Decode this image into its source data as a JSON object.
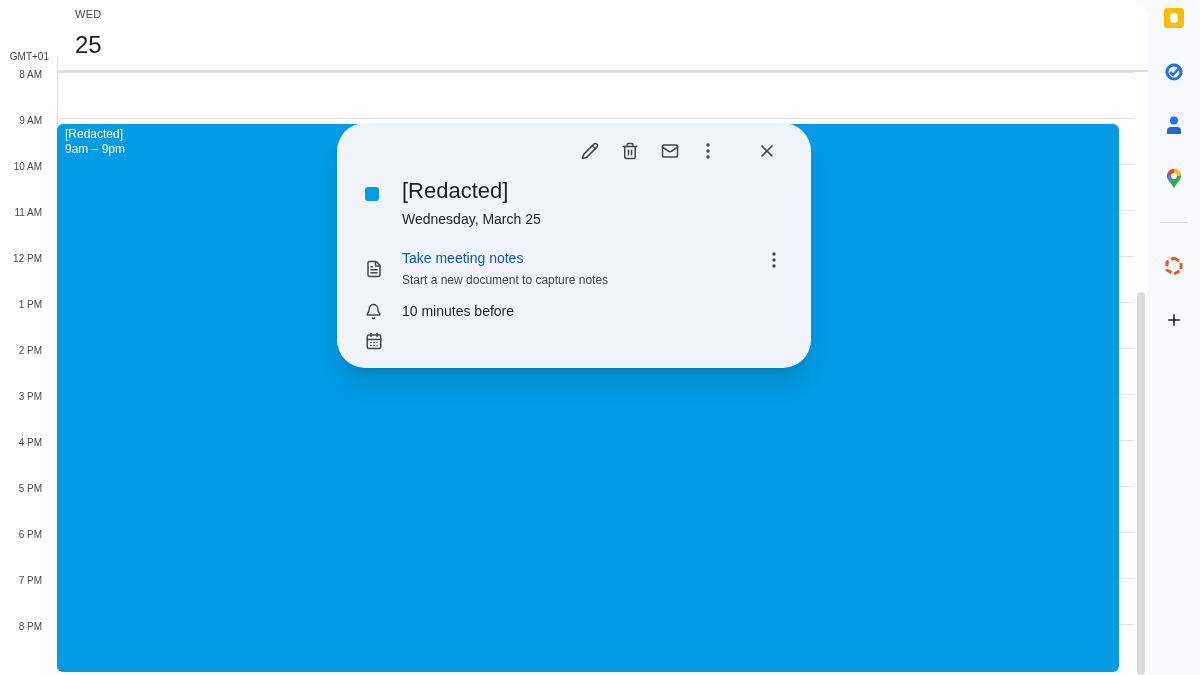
{
  "day_header": {
    "weekday": "WED",
    "date": "25"
  },
  "timezone": "GMT+01",
  "hours": [
    "8 AM",
    "9 AM",
    "10 AM",
    "11 AM",
    "12 PM",
    "1 PM",
    "2 PM",
    "3 PM",
    "4 PM",
    "5 PM",
    "6 PM",
    "7 PM",
    "8 PM"
  ],
  "event": {
    "title": "[Redacted]",
    "time": "9am – 9pm",
    "color": "#039be5"
  },
  "popup": {
    "title": "[Redacted]",
    "date": "Wednesday, March 25",
    "color": "#039be5",
    "notes_link": "Take meeting notes",
    "notes_hint": "Start a new document to capture notes",
    "reminder": "10 minutes before"
  },
  "side_panel": {
    "apps": [
      {
        "kind": "keep"
      },
      {
        "kind": "tasks"
      },
      {
        "kind": "contacts"
      },
      {
        "kind": "maps"
      },
      {
        "kind": "divider"
      },
      {
        "kind": "addon"
      },
      {
        "kind": "add"
      }
    ]
  }
}
